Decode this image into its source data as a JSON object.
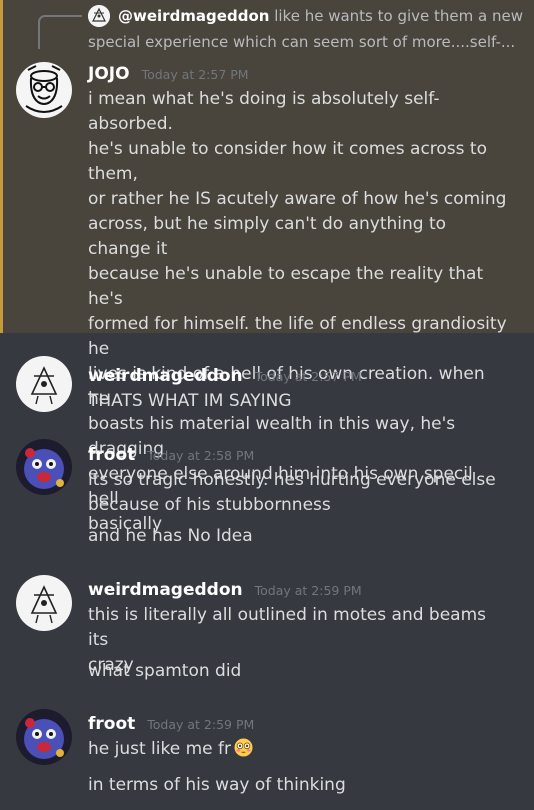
{
  "reply": {
    "author": "@weirdmageddon",
    "line1": "like he wants to give them a new",
    "line2": "special experience which can seem sort of more....self-..."
  },
  "messages": [
    {
      "author": "JOJO",
      "timestamp": "Today at 2:57 PM",
      "lines": [
        "i mean what he's doing is absolutely self-absorbed.",
        "he's unable to consider how it comes across to them,",
        "or rather he IS acutely aware of how he's coming",
        "across, but he simply can't do anything to change it",
        "because he's unable to escape the reality that he's",
        "formed for himself. the life of endless grandiosity he",
        "lives is kind of a hell of his own creation. when he",
        "boasts his material wealth in this way, he's dragging",
        "everyone else around him into his own specil hell",
        "basically"
      ]
    },
    {
      "author": "weirdmageddon",
      "timestamp": "Today at 2:57 PM",
      "lines": [
        "THATS WHAT IM SAYING"
      ]
    },
    {
      "author": "froot",
      "timestamp": "Today at 2:58 PM",
      "lines": [
        "its so tragic honestly. hes hurting everyone else",
        "because of his stubbornness"
      ],
      "followup": [
        "and he has No Idea"
      ]
    },
    {
      "author": "weirdmageddon",
      "timestamp": "Today at 2:59 PM",
      "lines": [
        "this is literally all outlined in motes and beams its",
        "crazy"
      ],
      "followup": [
        "what spamton did"
      ]
    },
    {
      "author": "froot",
      "timestamp": "Today at 2:59 PM",
      "lines": [
        "he just like me fr"
      ],
      "followup": [
        "in terms of his way of thinking"
      ]
    }
  ],
  "icons": {
    "reply_avatar": "weirdmageddon-avatar",
    "emoji": "flushed-face-emoji"
  },
  "colors": {
    "background": "#36393f",
    "mention_highlight": "#49443c",
    "mention_bar": "#c59a3c",
    "username": "#ffffff",
    "timestamp": "#72767d",
    "text": "#dcddde"
  }
}
